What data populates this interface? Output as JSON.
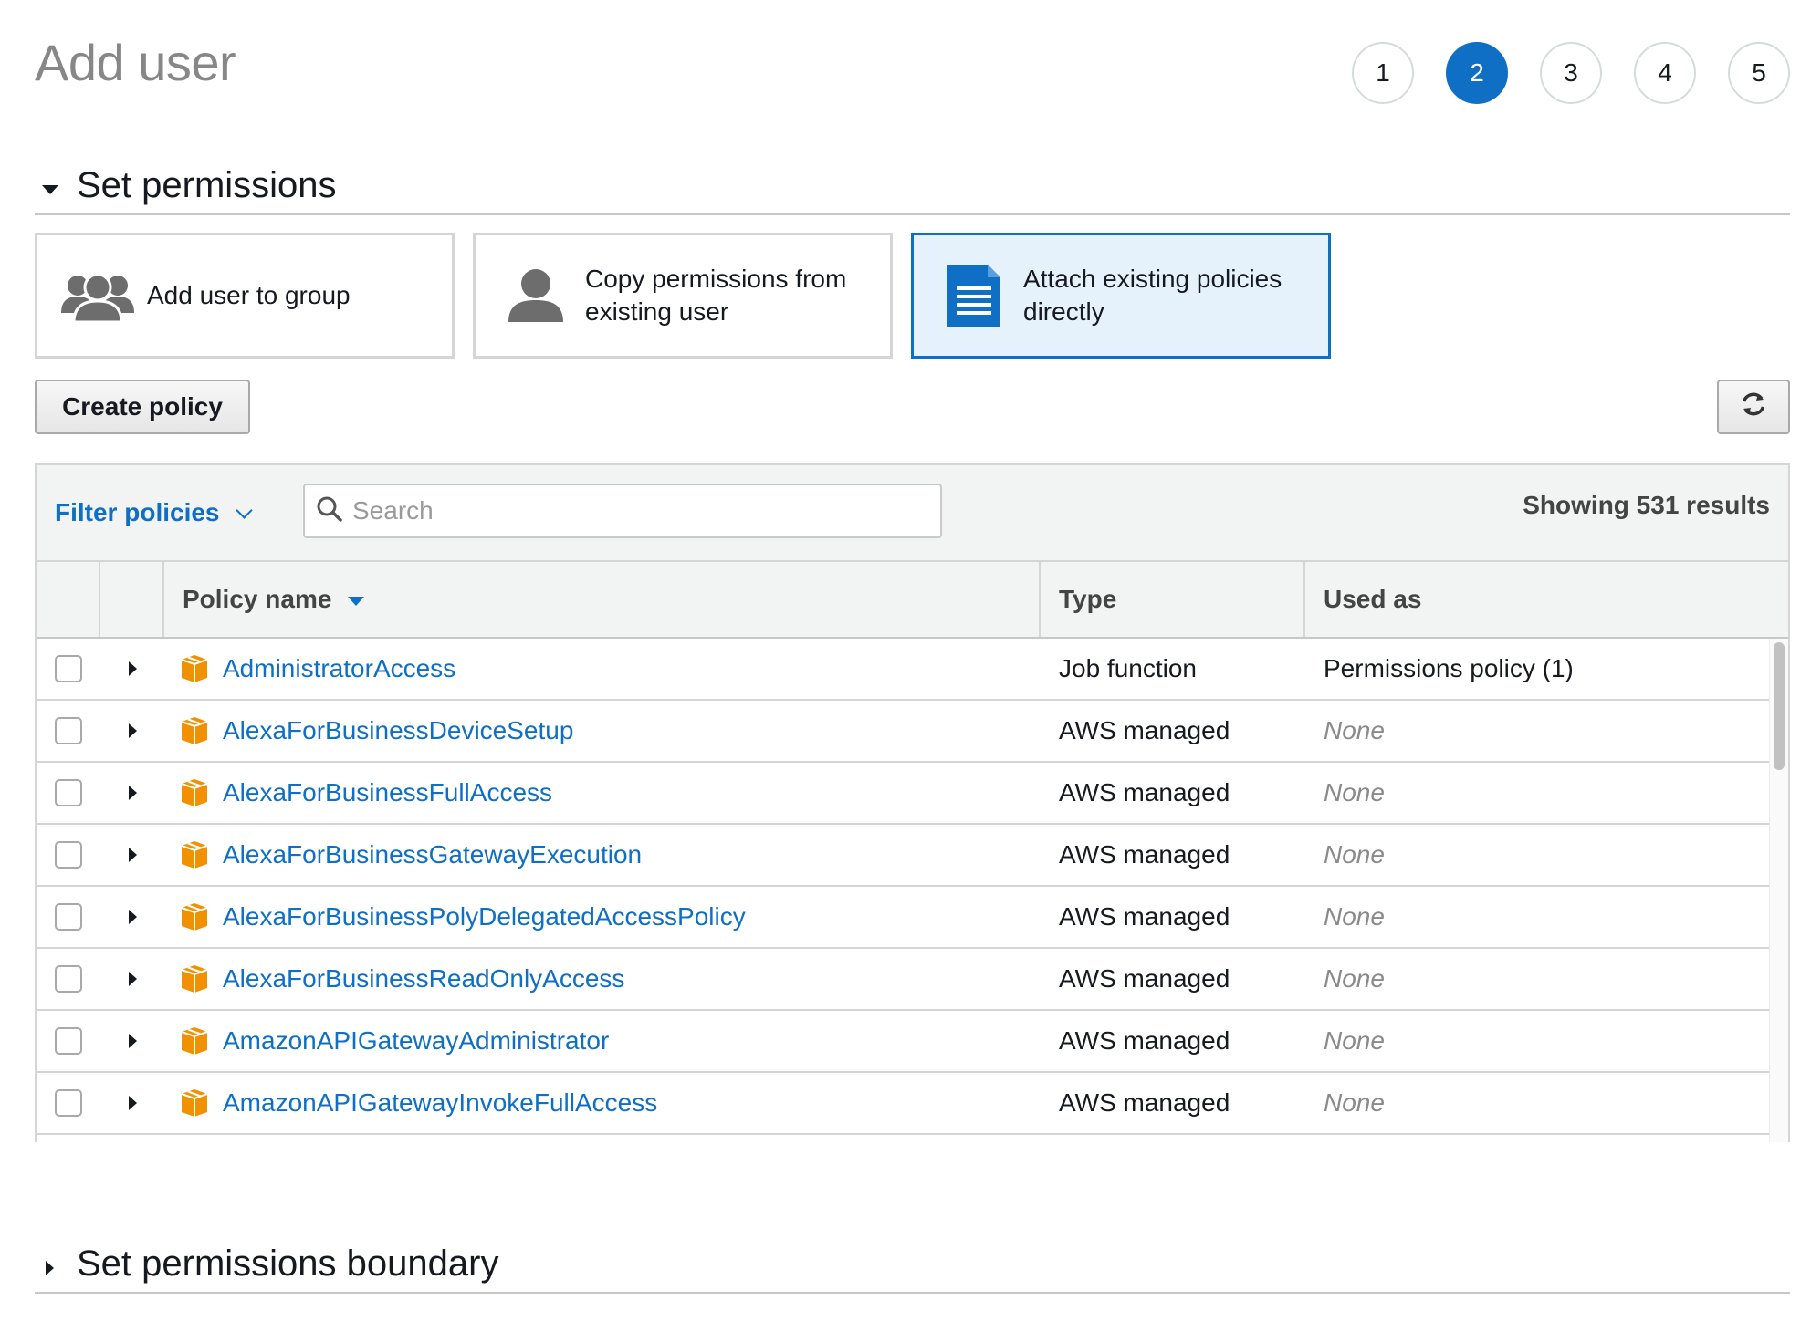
{
  "page": {
    "title": "Add user",
    "steps": [
      "1",
      "2",
      "3",
      "4",
      "5"
    ],
    "active_step": "2"
  },
  "set_permissions": {
    "heading": "Set permissions",
    "options": [
      {
        "line1": "Add user to group",
        "line2": "",
        "icon": "users-group-icon",
        "selected": false
      },
      {
        "line1": "Copy permissions from",
        "line2": "existing user",
        "icon": "user-icon",
        "selected": false
      },
      {
        "line1": "Attach existing policies",
        "line2": "directly",
        "icon": "document-icon",
        "selected": true
      }
    ],
    "create_policy_label": "Create policy",
    "refresh_icon": "refresh-icon"
  },
  "policies": {
    "filter_label": "Filter policies",
    "search_placeholder": "Search",
    "results_text": "Showing 531 results",
    "columns": {
      "name": "Policy name",
      "type": "Type",
      "used_as": "Used as"
    },
    "rows": [
      {
        "name": "AdministratorAccess",
        "type": "Job function",
        "used_as": "Permissions policy (1)"
      },
      {
        "name": "AlexaForBusinessDeviceSetup",
        "type": "AWS managed",
        "used_as": "None"
      },
      {
        "name": "AlexaForBusinessFullAccess",
        "type": "AWS managed",
        "used_as": "None"
      },
      {
        "name": "AlexaForBusinessGatewayExecution",
        "type": "AWS managed",
        "used_as": "None"
      },
      {
        "name": "AlexaForBusinessPolyDelegatedAccessPolicy",
        "type": "AWS managed",
        "used_as": "None"
      },
      {
        "name": "AlexaForBusinessReadOnlyAccess",
        "type": "AWS managed",
        "used_as": "None"
      },
      {
        "name": "AmazonAPIGatewayAdministrator",
        "type": "AWS managed",
        "used_as": "None"
      },
      {
        "name": "AmazonAPIGatewayInvokeFullAccess",
        "type": "AWS managed",
        "used_as": "None"
      }
    ]
  },
  "boundary": {
    "heading": "Set permissions boundary"
  },
  "colors": {
    "accent": "#0f6fc5",
    "selected_tile_bg": "#e6f2fb",
    "package_icon": "#f29100"
  }
}
